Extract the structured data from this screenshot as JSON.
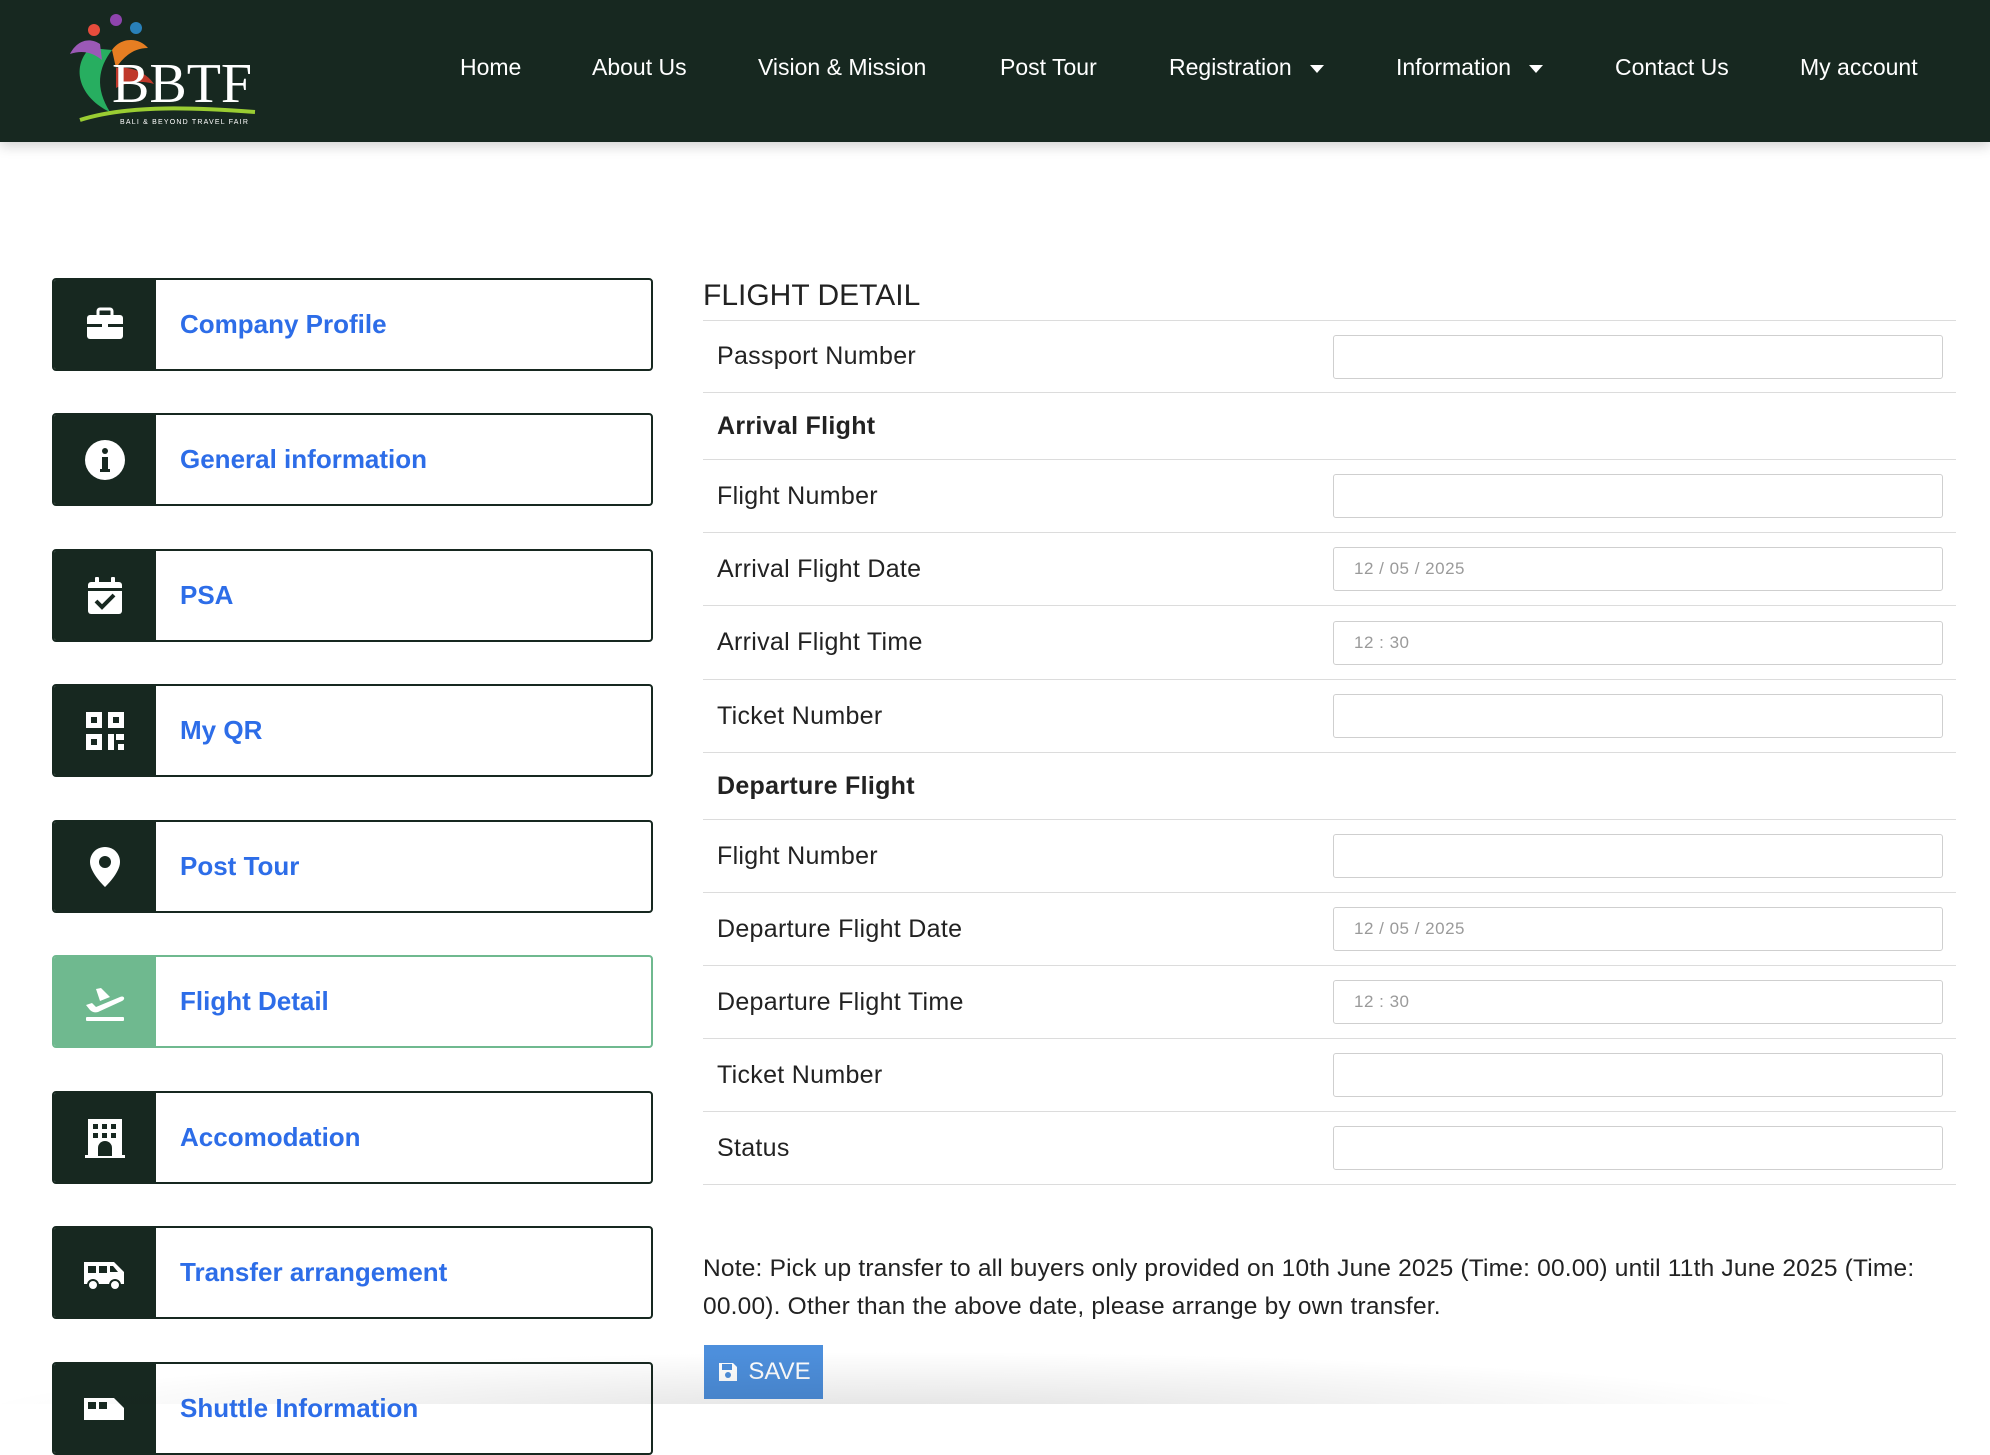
{
  "brand": {
    "name": "BBTF",
    "tagline": "BALI & BEYOND TRAVEL FAIR"
  },
  "nav": [
    {
      "label": "Home"
    },
    {
      "label": "About Us"
    },
    {
      "label": "Vision & Mission"
    },
    {
      "label": "Post Tour"
    },
    {
      "label": "Registration",
      "dropdown": true
    },
    {
      "label": "Information",
      "dropdown": true
    },
    {
      "label": "Contact Us"
    },
    {
      "label": "My account"
    }
  ],
  "sidebar": [
    {
      "label": "Company Profile",
      "icon": "briefcase-icon"
    },
    {
      "label": "General information",
      "icon": "info-icon"
    },
    {
      "label": "PSA",
      "icon": "calendar-check-icon"
    },
    {
      "label": "My QR",
      "icon": "qr-code-icon"
    },
    {
      "label": "Post Tour",
      "icon": "map-pin-icon"
    },
    {
      "label": "Flight Detail",
      "icon": "plane-departure-icon",
      "active": true
    },
    {
      "label": "Accomodation",
      "icon": "hotel-icon"
    },
    {
      "label": "Transfer arrangement",
      "icon": "van-icon"
    },
    {
      "label": "Shuttle Information",
      "icon": "shuttle-icon"
    }
  ],
  "form": {
    "title": "FLIGHT DETAIL",
    "passport_label": "Passport Number",
    "passport_value": "",
    "arrival_heading": "Arrival Flight",
    "arrival_flight_number_label": "Flight Number",
    "arrival_flight_number_value": "",
    "arrival_date_label": "Arrival Flight Date",
    "arrival_date_value": "12 / 05 / 2025",
    "arrival_time_label": "Arrival Flight Time",
    "arrival_time_value": "12 : 30",
    "arrival_ticket_label": "Ticket Number",
    "arrival_ticket_value": "",
    "departure_heading": "Departure Flight",
    "departure_flight_number_label": "Flight Number",
    "departure_flight_number_value": "",
    "departure_date_label": "Departure Flight Date",
    "departure_date_value": "12 / 05 / 2025",
    "departure_time_label": "Departure Flight Time",
    "departure_time_value": "12 : 30",
    "departure_ticket_label": "Ticket Number",
    "departure_ticket_value": "",
    "status_label": "Status",
    "status_value": ""
  },
  "note": "Note: Pick up transfer to all buyers only provided on 10th June 2025 (Time: 00.00) until 11th June 2025 (Time: 00.00). Other than the above date, please arrange by own transfer.",
  "save_label": "SAVE",
  "colors": {
    "header_bg": "#172820",
    "link_blue": "#2d6de8",
    "active_green": "#6fb98f",
    "save_blue": "#4d8fdc"
  }
}
